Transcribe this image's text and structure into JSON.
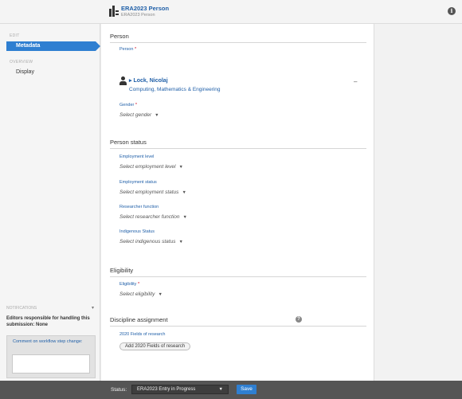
{
  "header": {
    "title": "ERA2023 Person",
    "subtitle": "ERA2023 Person"
  },
  "sidebar": {
    "sections": [
      {
        "heading": "EDIT",
        "items": [
          {
            "label": "Metadata",
            "active": true
          }
        ]
      },
      {
        "heading": "OVERVIEW",
        "items": [
          {
            "label": "Display",
            "active": false
          }
        ]
      }
    ],
    "notifications": {
      "heading": "NOTIFICATIONS",
      "editors_text": "Editors responsible for handling this submission: None",
      "comment_label": "Comment on workflow step change:"
    }
  },
  "main": {
    "person": {
      "title": "Person",
      "person_label": "Person",
      "person_name": "Lock, Nicolaj",
      "person_department": "Computing, Mathematics & Engineering",
      "gender_label": "Gender",
      "gender_placeholder": "Select gender"
    },
    "person_status": {
      "title": "Person status",
      "employment_level_label": "Employment level",
      "employment_level_placeholder": "Select employment level",
      "employment_status_label": "Employment status",
      "employment_status_placeholder": "Select employment status",
      "researcher_function_label": "Researcher function",
      "researcher_function_placeholder": "Select researcher function",
      "indigenous_status_label": "Indigenous Status",
      "indigenous_status_placeholder": "Select indigenous status"
    },
    "eligibility": {
      "title": "Eligibility",
      "eligibility_label": "Eligibility",
      "eligibility_placeholder": "Select eligibility"
    },
    "discipline": {
      "title": "Discipline assignment",
      "fields_label": "2020 Fields of research",
      "add_button": "Add 2020 Fields of research"
    }
  },
  "footer": {
    "status_label": "Status:",
    "status_value": "ERA2023 Entry in Progress",
    "save_label": "Save"
  },
  "colors": {
    "accent": "#2f7fd1",
    "link": "#1f5fa8",
    "required": "#d0021b",
    "footer_bg": "#555555"
  }
}
